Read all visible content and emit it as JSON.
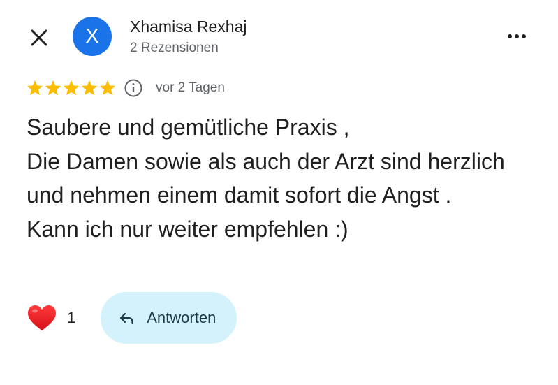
{
  "header": {
    "close_icon": "close-icon",
    "more_icon": "more-horizontal-icon"
  },
  "reviewer": {
    "avatar_letter": "X",
    "avatar_color": "#1a73e8",
    "name": "Xhamisa Rexhaj",
    "review_count_text": "2 Rezensionen"
  },
  "review": {
    "rating": 5,
    "rating_max": 5,
    "star_color": "#fbbc04",
    "info_icon": "info-icon",
    "date": "vor 2 Tagen",
    "text": "Saubere und gemütliche Praxis ,\nDie Damen sowie als auch der Arzt sind herzlich und nehmen einem damit sofort die Angst .\nKann ich nur weiter empfehlen :)"
  },
  "actions": {
    "like_icon": "heart-icon",
    "like_count": "1",
    "reply_icon": "reply-arrow-icon",
    "reply_label": "Antworten",
    "reply_bg": "#d3f2fb"
  }
}
